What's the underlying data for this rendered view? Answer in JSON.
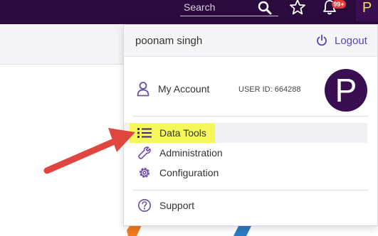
{
  "header": {
    "search_placeholder": "Search",
    "notification_count": "99+",
    "avatar_initial": "P",
    "icons": [
      "search-icon",
      "star-icon",
      "bell-icon"
    ]
  },
  "dropdown": {
    "user_name": "poonam singh",
    "logout_label": "Logout",
    "my_account_label": "My Account",
    "user_id": "USER ID: 664288",
    "avatar_initial": "P",
    "items": [
      {
        "label": "Data Tools",
        "icon": "list-icon",
        "active": true,
        "highlighted": true
      },
      {
        "label": "Administration",
        "icon": "wrench-icon"
      },
      {
        "label": "Configuration",
        "icon": "gear-icon"
      },
      {
        "label": "Support",
        "icon": "help-icon"
      }
    ]
  },
  "colors": {
    "topbar": "#2b0a3d",
    "accent": "#5a3fc0",
    "icon_purple": "#6a4fa8",
    "highlight": "#f5f75a",
    "annotation_arrow": "#e0463f",
    "badge": "#e53935"
  }
}
